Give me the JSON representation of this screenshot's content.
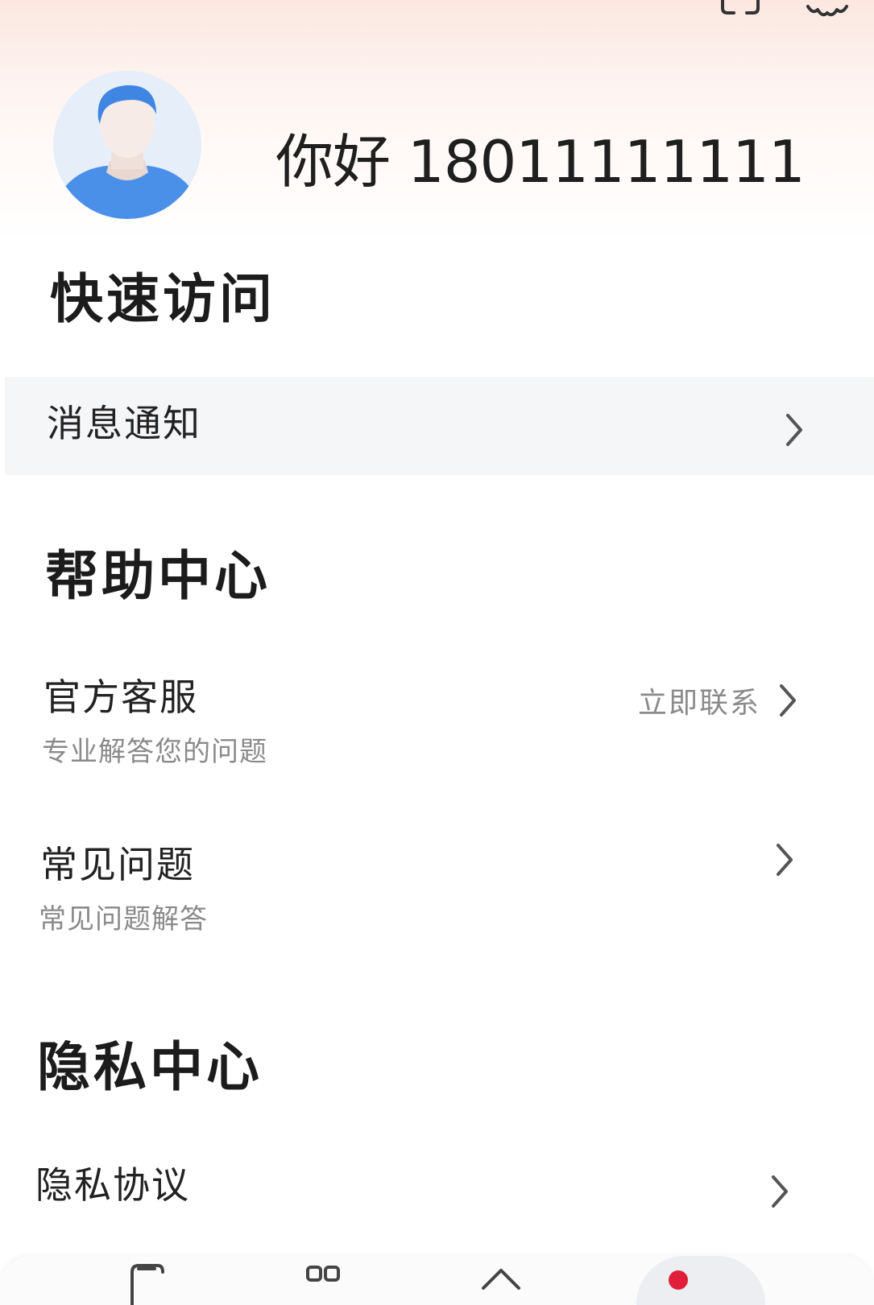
{
  "header": {
    "greeting": "你好 18011111111",
    "icons": [
      "scan-icon",
      "gear-icon"
    ]
  },
  "quick_access": {
    "title": "快速访问",
    "items": [
      {
        "label": "消息通知"
      }
    ]
  },
  "help_center": {
    "title": "帮助中心",
    "items": [
      {
        "label": "官方客服",
        "sub": "专业解答您的问题",
        "extra": "立即联系"
      },
      {
        "label": "常见问题",
        "sub": "常见问题解答"
      }
    ]
  },
  "privacy_center": {
    "title": "隐私中心",
    "items": [
      {
        "label": "隐私协议"
      }
    ]
  },
  "bottom_nav": {
    "tabs": [
      "document-icon",
      "grid-icon",
      "home-icon",
      "profile-icon"
    ],
    "active_color": "#e0203a"
  }
}
